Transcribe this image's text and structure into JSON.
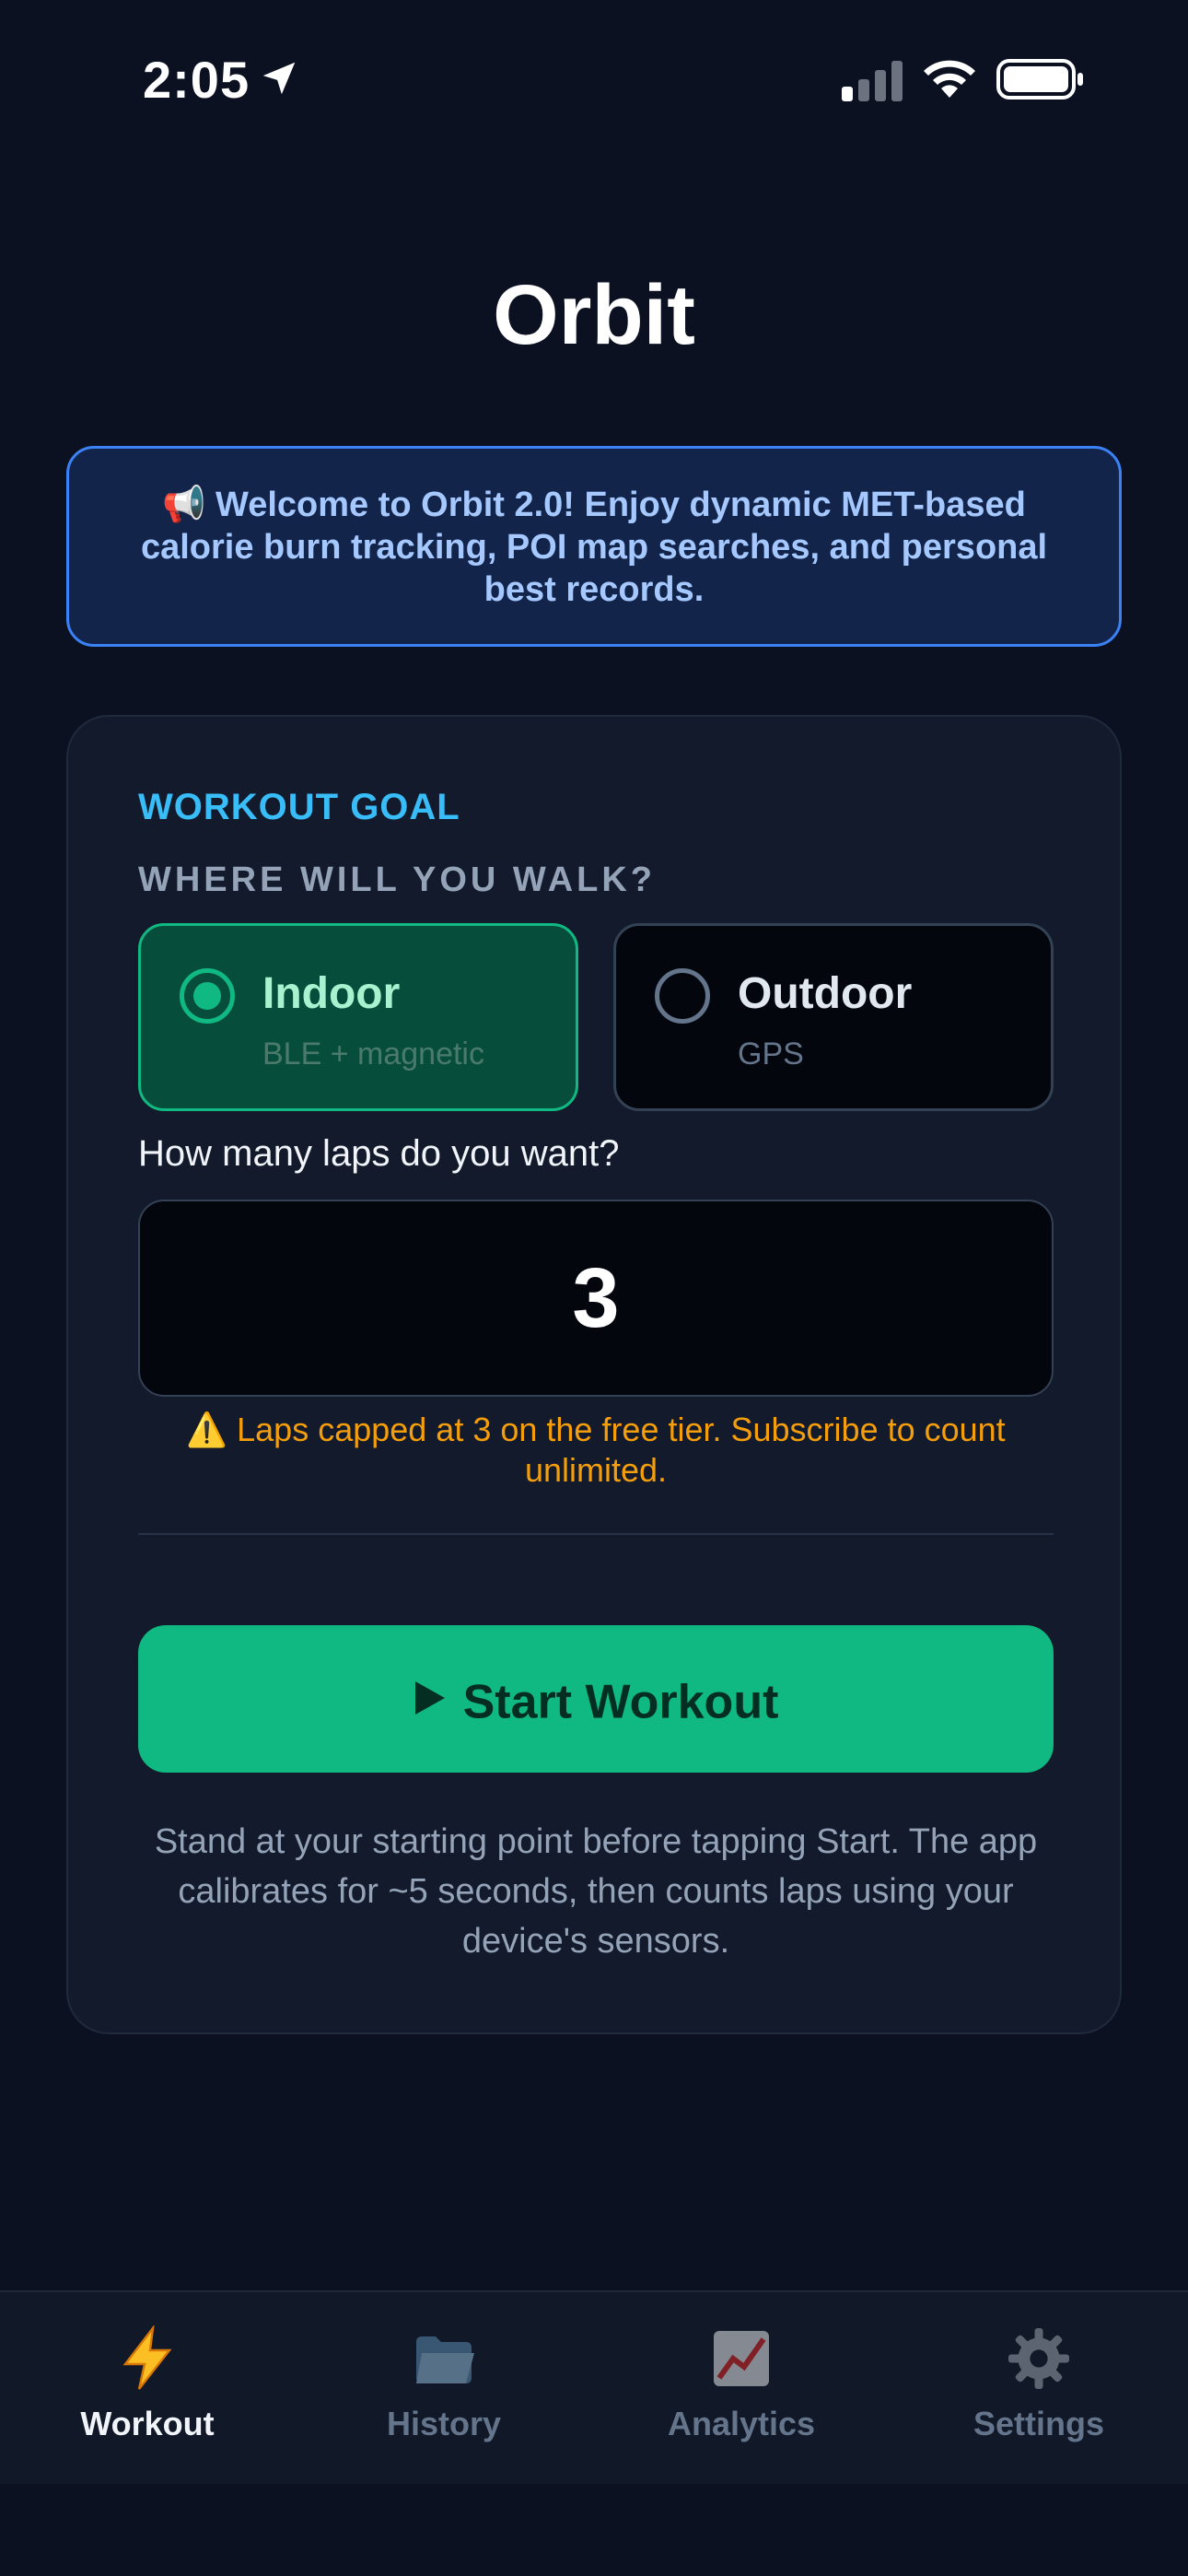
{
  "status_bar": {
    "time": "2:05"
  },
  "app": {
    "title": "Orbit"
  },
  "announcement": {
    "text": "📢 Welcome to Orbit 2.0! Enjoy dynamic MET-based calorie burn tracking, POI map searches, and personal best records."
  },
  "goal": {
    "section_title": "WORKOUT GOAL",
    "location_label": "WHERE WILL YOU WALK?",
    "options": [
      {
        "title": "Indoor",
        "subtitle": "BLE + magnetic",
        "selected": true
      },
      {
        "title": "Outdoor",
        "subtitle": "GPS",
        "selected": false
      }
    ],
    "laps_label": "How many laps do you want?",
    "laps_value": "3",
    "warning": "⚠️ Laps capped at 3 on the free tier. Subscribe to count unlimited.",
    "start_label": "Start Workout",
    "hint": "Stand at your starting point before tapping Start. The app calibrates for ~5 seconds, then counts laps using your device's sensors."
  },
  "tabs": [
    {
      "label": "Workout",
      "icon": "lightning-icon",
      "active": true
    },
    {
      "label": "History",
      "icon": "folder-icon",
      "active": false
    },
    {
      "label": "Analytics",
      "icon": "chart-icon",
      "active": false
    },
    {
      "label": "Settings",
      "icon": "gear-icon",
      "active": false
    }
  ],
  "colors": {
    "background": "#0b1120",
    "accent_green": "#10b981",
    "accent_blue": "#38bdf8",
    "warning": "#f59e0b"
  }
}
